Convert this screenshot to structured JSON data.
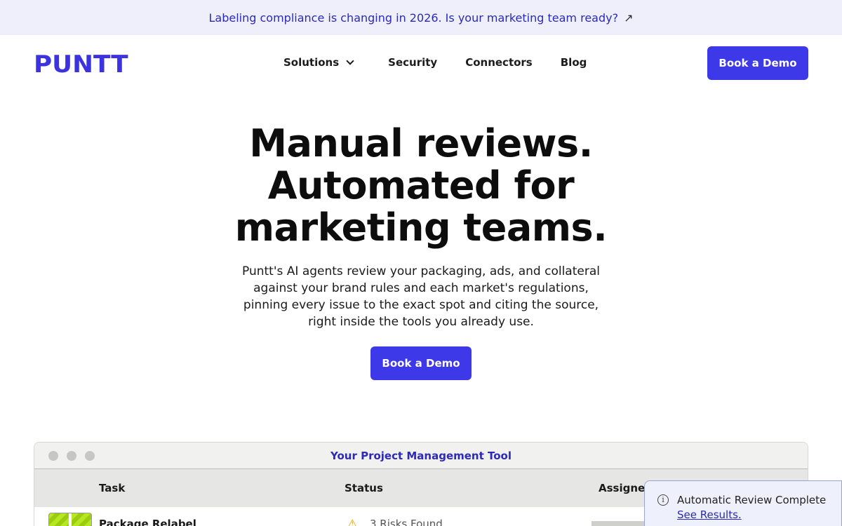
{
  "banner": {
    "text": "Labeling compliance is changing in 2026. Is your marketing team ready?",
    "arrow_icon": "↗"
  },
  "nav": {
    "logo": "PUNTT",
    "links": [
      {
        "label": "Solutions",
        "has_dropdown": true
      },
      {
        "label": "Security"
      },
      {
        "label": "Connectors"
      },
      {
        "label": "Blog"
      }
    ],
    "cta": "Book a Demo"
  },
  "hero": {
    "title_lines": [
      "Manual reviews.",
      "Automated for",
      "marketing teams."
    ],
    "subtitle_lines": [
      "Puntt's AI agents review your packaging, ads, and collateral",
      "against your brand rules and each market's regulations,",
      "pinning every issue to the exact spot and citing the source,",
      "right inside the tools you already use."
    ],
    "cta": "Book a Demo"
  },
  "window": {
    "title": "Your Project Management Tool",
    "columns": [
      "Task",
      "Status",
      "Assignee"
    ],
    "rows": [
      {
        "task": "Package Relabel",
        "status": "3 Risks Found"
      }
    ]
  },
  "toast": {
    "text": "Automatic Review Complete",
    "link": "See Results."
  },
  "colors": {
    "accent": "#3d38e8",
    "banner_bg": "#efeffc",
    "link": "#2a2ab8"
  }
}
